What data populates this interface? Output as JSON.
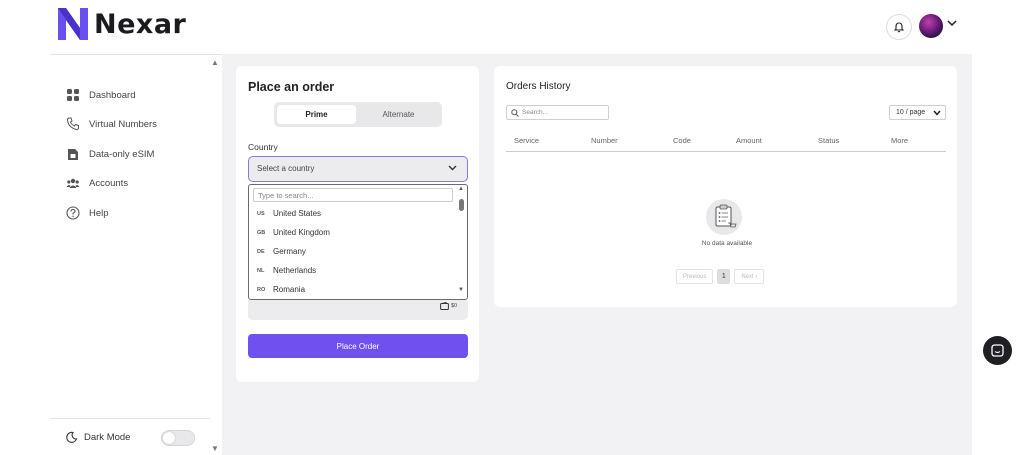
{
  "brand": {
    "name": "Nexar"
  },
  "header": {
    "notification_icon": "bell-icon",
    "avatar_icon": "user-avatar",
    "menu_icon": "chevron-down-icon"
  },
  "sidebar": {
    "items": [
      {
        "label": "Dashboard",
        "icon": "grid-icon"
      },
      {
        "label": "Virtual Numbers",
        "icon": "phone-icon"
      },
      {
        "label": "Data-only eSIM",
        "icon": "sim-icon"
      },
      {
        "label": "Accounts",
        "icon": "users-icon"
      },
      {
        "label": "Help",
        "icon": "help-icon"
      }
    ],
    "dark_mode_label": "Dark Mode",
    "dark_mode_on": false
  },
  "order": {
    "title": "Place an order",
    "tabs": [
      "Prime",
      "Alternate"
    ],
    "active_tab": "Prime",
    "country_label": "Country",
    "country_placeholder": "Select a country",
    "search_placeholder": "Type to search...",
    "countries": [
      {
        "code": "US",
        "name": "United States"
      },
      {
        "code": "GB",
        "name": "United Kingdom"
      },
      {
        "code": "DE",
        "name": "Germany"
      },
      {
        "code": "NL",
        "name": "Netherlands"
      },
      {
        "code": "RO",
        "name": "Romania"
      }
    ],
    "wallet_amount": "$0",
    "submit_label": "Place Order"
  },
  "history": {
    "title": "Orders History",
    "search_placeholder": "Search...",
    "per_page": "10 / page",
    "columns": [
      "Service",
      "Number",
      "Code",
      "Amount",
      "Status",
      "More"
    ],
    "empty_text": "No data available",
    "pager": {
      "prev": "Previous",
      "page": "1",
      "next": "Next"
    }
  },
  "colors": {
    "accent": "#7050ef",
    "bg": "#f2f2f4"
  }
}
